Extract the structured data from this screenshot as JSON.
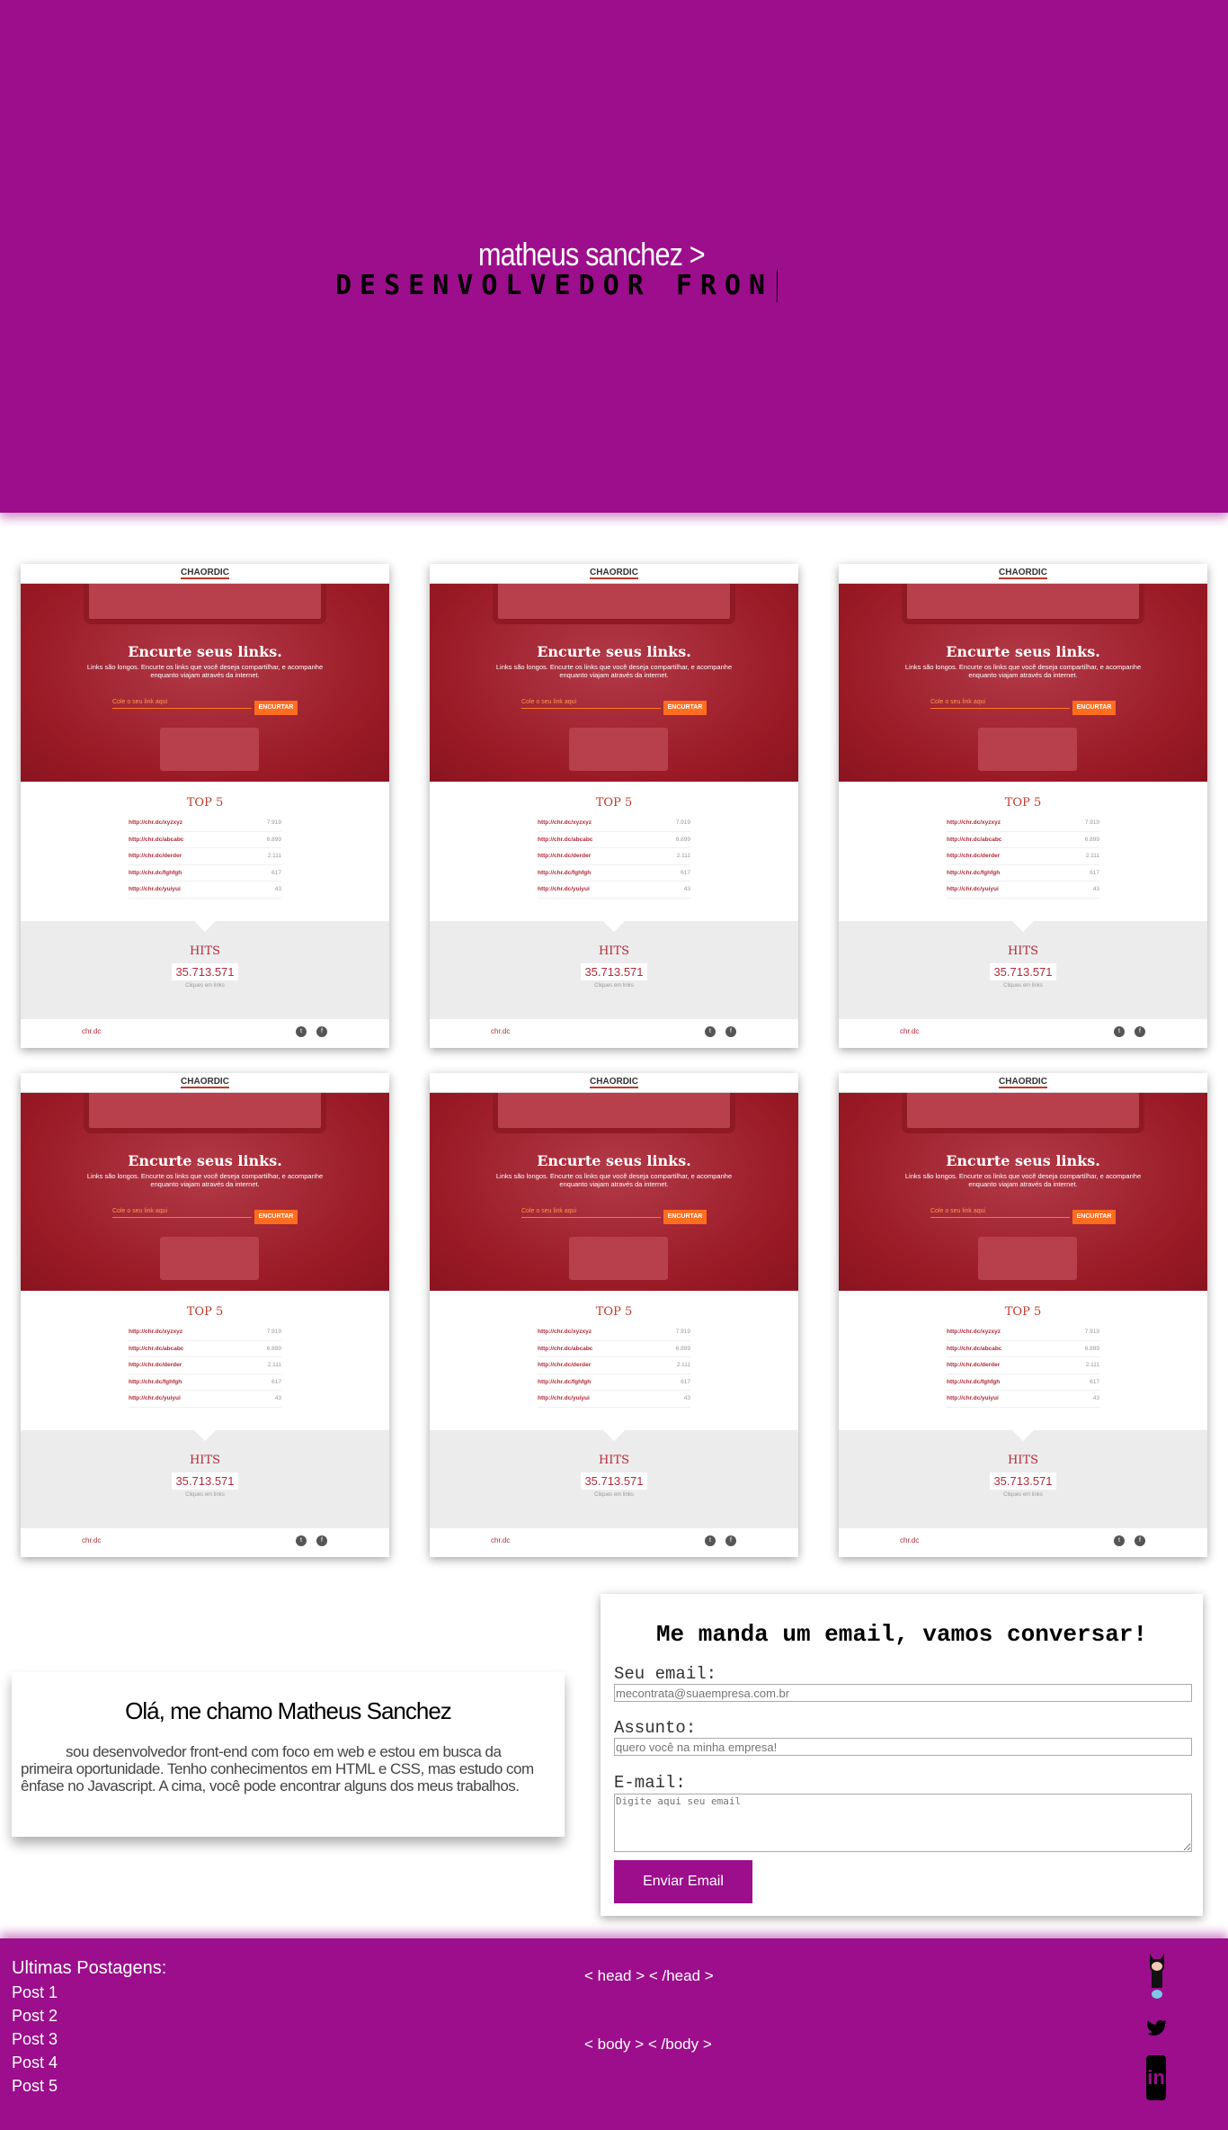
{
  "hero": {
    "name": "matheus sanchez >",
    "role": "DESENVOLVEDOR FRON"
  },
  "card": {
    "logo": "CHAORDIC",
    "title": "Encurte seus links.",
    "subtitle": "Links são longos. Encurte os links que você deseja compartilhar, e acompanhe enquanto viajam através da internet.",
    "input_placeholder": "Cole o seu link aqui",
    "button": "ENCURTAR",
    "top_title": "TOP 5",
    "links": [
      {
        "url": "http://chr.dc/xyzxyz",
        "count": "7.919"
      },
      {
        "url": "http://chr.dc/abcabc",
        "count": "6.899"
      },
      {
        "url": "http://chr.dc/derder",
        "count": "2.111"
      },
      {
        "url": "http://chr.dc/fghfgh",
        "count": "617"
      },
      {
        "url": "http://chr.dc/yuiyui",
        "count": "43"
      }
    ],
    "hits_title": "HITS",
    "hits": "35.713.571",
    "hits_caption": "Cliques em links",
    "domain": "chr.dc",
    "twitter_glyph": "t",
    "facebook_glyph": "f"
  },
  "about": {
    "title": "Olá, me chamo Matheus Sanchez",
    "text": "sou desenvolvedor front-end com foco em web e estou em busca da primeira oportunidade. Tenho conhecimentos em HTML e CSS, mas estudo com ênfase no Javascript. A cima, você pode encontrar alguns dos meus trabalhos."
  },
  "contact": {
    "title": "Me manda um email, vamos conversar!",
    "email_label": "Seu email:",
    "email_placeholder": "mecontrata@suaempresa.com.br",
    "subject_label": "Assunto:",
    "subject_placeholder": "quero você na minha empresa!",
    "message_label": "E-mail:",
    "message_placeholder": "Digite aqui seu email",
    "submit": "Enviar Email"
  },
  "footer": {
    "posts_title": "Ultimas Postagens:",
    "posts": [
      "Post 1",
      "Post 2",
      "Post 3",
      "Post 4",
      "Post 5"
    ],
    "head": "< head > < /head >",
    "body": "< body > < /body >",
    "icons": [
      "github-octocat-icon",
      "twitter-icon",
      "linkedin-icon"
    ]
  },
  "colors": {
    "brand": "#9c0e8c",
    "card_red": "#9a1a26",
    "accent_orange": "#ff6d1f"
  }
}
